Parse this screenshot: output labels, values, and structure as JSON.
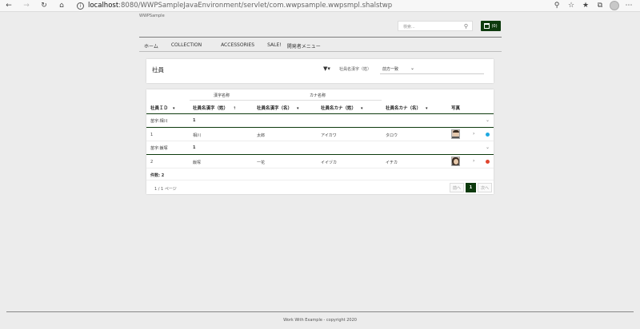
{
  "browser": {
    "url_host": "localhost",
    "url_path": ":8080/WWPSampleJavaEnvironment/servlet/com.wwpsample.wwpsmpl.shalstwp"
  },
  "app": {
    "title": "WWPSample",
    "search_placeholder": "検索...",
    "cart_badge": "(0)"
  },
  "menu": [
    "ホーム",
    "COLLECTION",
    "ACCESSORIES",
    "SALE!",
    "開発者メニュー"
  ],
  "page": {
    "title": "社員",
    "filter_label": "社員名漢字（姓）",
    "filter_value": "前方一致"
  },
  "grid": {
    "group_headers": [
      "漢字名称",
      "カナ名称"
    ],
    "columns": [
      "社員ＩＤ",
      "社員名漢字（姓）",
      "社員名漢字（名）",
      "社員名カナ（姓）",
      "社員名カナ（名）",
      "写真"
    ],
    "sort_markers": [
      "▾",
      "↑",
      "▾",
      "▾",
      "▾"
    ],
    "groups": [
      {
        "label": "苗字:相川",
        "count": "1",
        "rows": [
          {
            "id": "1",
            "sei": "相川",
            "mei": "太郎",
            "kana_sei": "アイカワ",
            "kana_mei": "タロウ",
            "status_color": "#1fa9e1"
          }
        ]
      },
      {
        "label": "苗字:飯塚",
        "count": "1",
        "rows": [
          {
            "id": "2",
            "sei": "飯塚",
            "mei": "一花",
            "kana_sei": "イイヅカ",
            "kana_mei": "イチカ",
            "status_color": "#e0452e"
          }
        ]
      }
    ],
    "count_label": "件数: 2",
    "page_info": "1 / 1 ページ",
    "pager": {
      "prev": "前へ",
      "current": "1",
      "next": "次へ"
    }
  },
  "footer": "Work With Example - copyright 2020"
}
